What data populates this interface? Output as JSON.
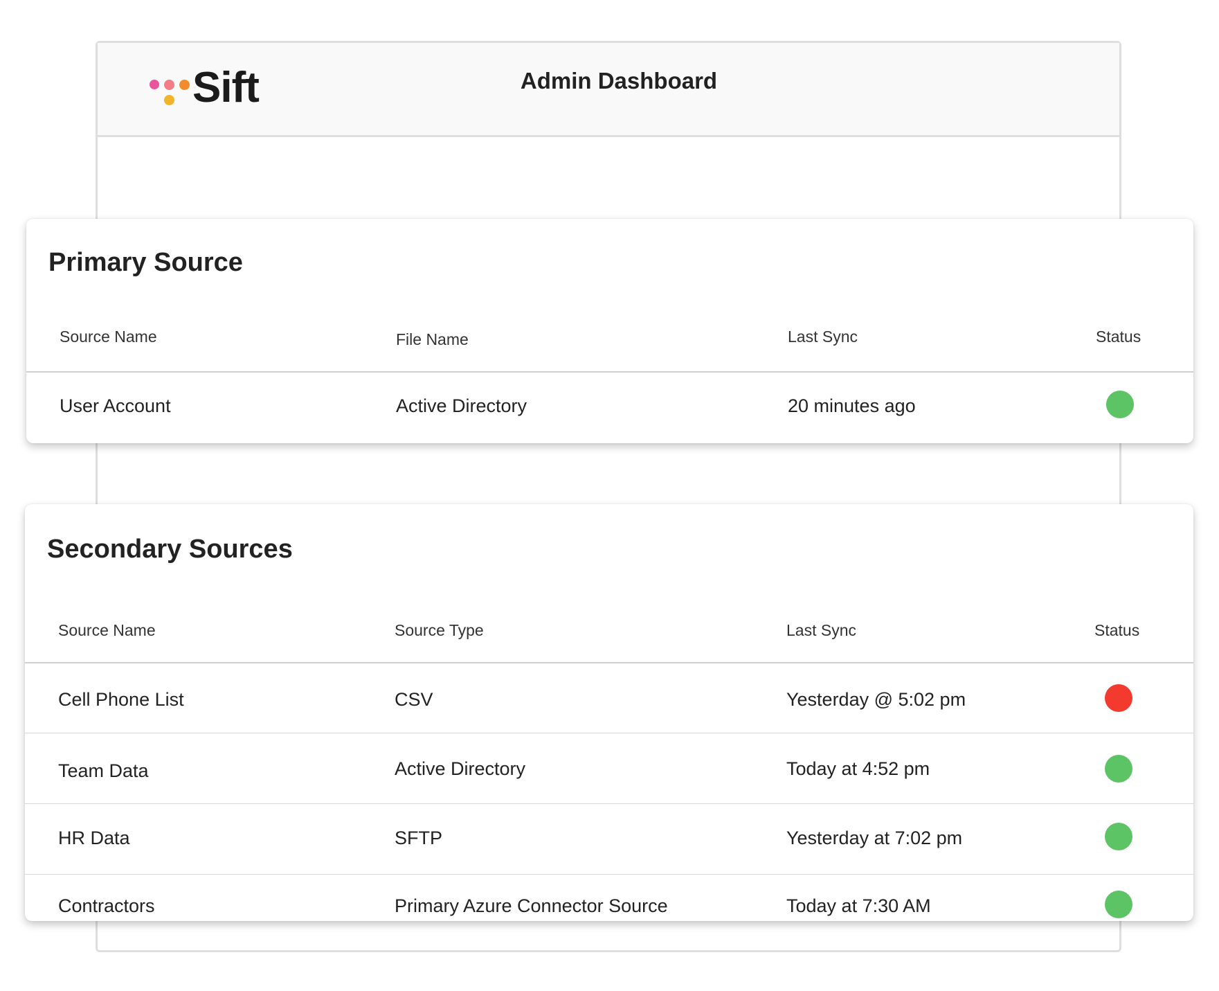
{
  "app": {
    "brand": "Sift",
    "title": "Admin Dashboard"
  },
  "colors": {
    "logo_dot_pink": "#e9559a",
    "logo_dot_rose": "#f27d86",
    "logo_dot_orange": "#f28b2b",
    "logo_dot_yellow": "#f2b42a",
    "status_ok": "#5cc465",
    "status_error": "#f23a2e"
  },
  "primary": {
    "title": "Primary Source",
    "columns": [
      "Source Name",
      "File Name",
      "Last Sync",
      "Status"
    ],
    "rows": [
      {
        "source_name": "User Account",
        "file_name": "Active Directory",
        "last_sync": "20 minutes ago",
        "status": "ok"
      }
    ]
  },
  "secondary": {
    "title": "Secondary Sources",
    "columns": [
      "Source Name",
      "Source Type",
      "Last Sync",
      "Status"
    ],
    "rows": [
      {
        "source_name": "Cell Phone List",
        "source_type": "CSV",
        "last_sync": "Yesterday @ 5:02 pm",
        "status": "error"
      },
      {
        "source_name": "Team Data",
        "source_type": "Active Directory",
        "last_sync": "Today at 4:52 pm",
        "status": "ok"
      },
      {
        "source_name": "HR Data",
        "source_type": "SFTP",
        "last_sync": "Yesterday at 7:02 pm",
        "status": "ok"
      },
      {
        "source_name": "Contractors",
        "source_type": "Primary Azure Connector Source",
        "last_sync": "Today at 7:30 AM",
        "status": "ok"
      }
    ]
  }
}
